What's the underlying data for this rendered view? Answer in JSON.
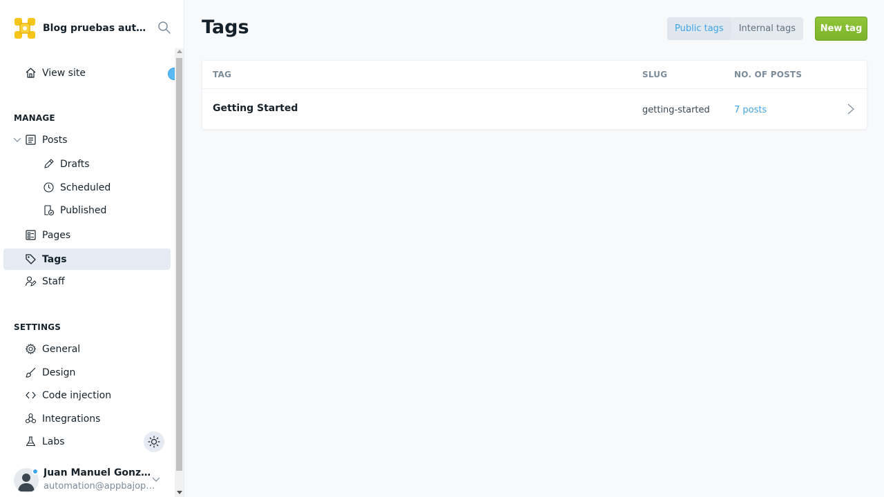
{
  "brand": {
    "title": "Blog pruebas automatizadas"
  },
  "sidebar": {
    "view_site": "View site",
    "manage_label": "MANAGE",
    "settings_label": "SETTINGS",
    "posts": "Posts",
    "drafts": "Drafts",
    "scheduled": "Scheduled",
    "published": "Published",
    "pages": "Pages",
    "tags": "Tags",
    "staff": "Staff",
    "general": "General",
    "design": "Design",
    "code_injection": "Code injection",
    "integrations": "Integrations",
    "labs": "Labs"
  },
  "user": {
    "name": "Juan Manuel González",
    "email": "automation@appbajopruebas.com"
  },
  "main": {
    "title": "Tags",
    "tabs": [
      {
        "label": "Public tags",
        "active": true
      },
      {
        "label": "Internal tags",
        "active": false
      }
    ],
    "new_tag_button": "New tag",
    "table": {
      "headers": {
        "tag": "TAG",
        "slug": "SLUG",
        "posts": "NO. OF POSTS"
      },
      "rows": [
        {
          "name": "Getting Started",
          "slug": "getting-started",
          "posts": "7 posts"
        }
      ]
    }
  },
  "colors": {
    "accent": "#3ea5e8",
    "primary_button": "#85bc30",
    "active_nav_bg": "#e5eaf3"
  },
  "icons": [
    "search-icon",
    "home-icon",
    "posts-icon",
    "pencil-icon",
    "clock-icon",
    "published-icon",
    "pages-icon",
    "tag-icon",
    "staff-icon",
    "gear-icon",
    "brush-icon",
    "code-icon",
    "integrations-icon",
    "flask-icon",
    "sun-icon",
    "chevron-right-icon"
  ]
}
